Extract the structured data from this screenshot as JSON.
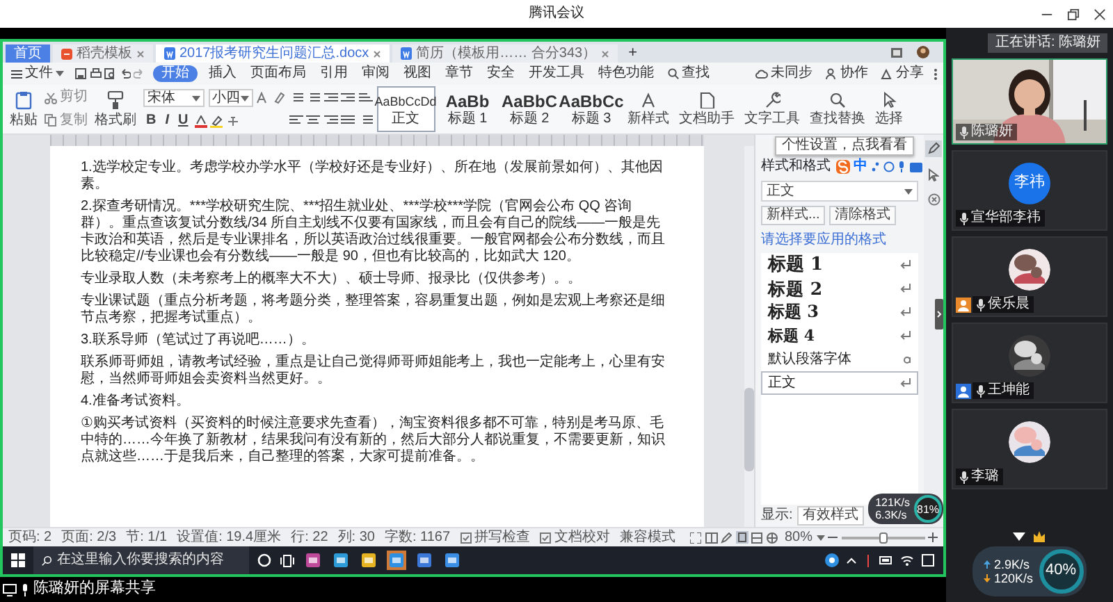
{
  "window": {
    "title": "腾讯会议"
  },
  "screen_share": {
    "doc_tabs": [
      {
        "label": "首页",
        "kind": "home",
        "selected": false
      },
      {
        "label": "稻壳模板",
        "kind": "template",
        "selected": false
      },
      {
        "label": "2017报考研究生问题汇总.docx",
        "kind": "doc",
        "selected": true
      },
      {
        "label": "简历（模板用…… 合分343）",
        "kind": "doc",
        "selected": false
      }
    ],
    "new_tab": "+",
    "file_menu": "文件",
    "menu": [
      {
        "label": "开始",
        "selected": true
      },
      {
        "label": "插入",
        "selected": false
      },
      {
        "label": "页面布局",
        "selected": false
      },
      {
        "label": "引用",
        "selected": false
      },
      {
        "label": "审阅",
        "selected": false
      },
      {
        "label": "视图",
        "selected": false
      },
      {
        "label": "章节",
        "selected": false
      },
      {
        "label": "安全",
        "selected": false
      },
      {
        "label": "开发工具",
        "selected": false
      },
      {
        "label": "特色功能",
        "selected": false
      }
    ],
    "menu_search": "查找",
    "menu_right": [
      {
        "label": "未同步",
        "kind": "cloud"
      },
      {
        "label": "协作",
        "kind": "people"
      },
      {
        "label": "分享",
        "kind": "share"
      }
    ],
    "toolbar": {
      "paste": "粘贴",
      "cut": "剪切",
      "copy": "复制",
      "format_painter": "格式刷",
      "font": "宋体",
      "font_size": "小四",
      "format_buttons": [
        "B",
        "I",
        "U"
      ],
      "styles": [
        {
          "sample": "AaBbCcDd",
          "label": "正文",
          "selected": true
        },
        {
          "sample": "AaBb",
          "label": "标题 1",
          "selected": false
        },
        {
          "sample": "AaBbC",
          "label": "标题 2",
          "selected": false
        },
        {
          "sample": "AaBbCc",
          "label": "标题 3",
          "selected": false
        }
      ],
      "tools": [
        {
          "label": "新样式",
          "kind": "style"
        },
        {
          "label": "文档助手",
          "kind": "assistant"
        },
        {
          "label": "文字工具",
          "kind": "wrench"
        },
        {
          "label": "查找替换",
          "kind": "search"
        },
        {
          "label": "选择",
          "kind": "cursor"
        }
      ],
      "tooltip": "个性设置，点我看看"
    },
    "document": {
      "paragraphs": [
        "1.选学校定专业。考虑学校办学水平（学校好还是专业好）、所在地（发展前景如何）、其他因素。",
        "2.探查考研情况。***学校研究生院、***招生就业处、***学校***学院（官网会公布 QQ 咨询群）。重点查该复试分数线/34 所自主划线不仅要有国家线，而且会有自己的院线——一般是先卡政治和英语，然后是专业课排名，所以英语政治过线很重要。一般官网都会公布分数线，而且比较稳定//专业课也会有分数线——一般是 90，但也有比较高的，比如武大 120。",
        "专业录取人数（未考察考上的概率大不大）、硕士导师、报录比（仅供参考）。。",
        "专业课试题（重点分析考题，将考题分类，整理答案，容易重复出题，例如是宏观上考察还是细节点考察，把握考试重点）。",
        "3.联系导师（笔试过了再说吧……）。",
        "联系师哥师姐，请教考试经验，重点是让自己觉得师哥师姐能考上，我也一定能考上，心里有安慰，当然师哥师姐会卖资料当然更好。。",
        "4.准备考试资料。",
        "①购买考试资料（买资料的时候注意要求先查看），淘宝资料很多都不可靠，特别是考马原、毛中特的……今年换了新教材，结果我问有没有新的，然后大部分人都说重复，不需要更新，知识点就这些……于是我后来，自己整理的答案，大家可提前准备。。"
      ]
    },
    "style_panel": {
      "title": "样式和格式",
      "current": "正文",
      "buttons": [
        "新样式...",
        "清除格式"
      ],
      "prompt": "请选择要应用的格式",
      "styles": [
        {
          "label": "标题 1",
          "kind": "heading",
          "selected": false
        },
        {
          "label": "标题 2",
          "kind": "heading",
          "selected": false
        },
        {
          "label": "标题 3",
          "kind": "heading",
          "selected": false
        },
        {
          "label": "标题 4",
          "kind": "heading",
          "selected": false
        },
        {
          "label": "默认段落字体",
          "kind": "character",
          "selected": false
        },
        {
          "label": "正文",
          "kind": "paragraph",
          "selected": true
        }
      ],
      "show_label": "显示:",
      "show_value": "有效样式"
    },
    "ime": {
      "mode": "中"
    },
    "net_monitor": {
      "upload": "121K/s",
      "download": "6.3K/s",
      "usage": "81%"
    },
    "status_bar": {
      "items": [
        "页码: 2",
        "页面: 2/3",
        "节: 1/1",
        "设置值: 19.4厘米",
        "行: 22",
        "列: 30",
        "字数: 1167"
      ],
      "checks": [
        "拼写检查",
        "文档校对"
      ],
      "mode": "兼容模式",
      "zoom": "80%",
      "zoom_slider": {
        "level": 0.5
      }
    },
    "taskbar": {
      "search_placeholder": "在这里输入你要搜索的内容"
    }
  },
  "share_label": "陈璐妍的屏幕共享",
  "participants": {
    "speaking": "正在讲话: 陈璐妍",
    "tiles": [
      {
        "name": "陈璐妍",
        "kind": "video"
      },
      {
        "name": "宣华部李祎",
        "kind": "initials",
        "avatar_text": "李祎"
      },
      {
        "name": "侯乐晨",
        "color": "#e8892c"
      },
      {
        "name": "王坤能",
        "color": "#2b6fd8"
      },
      {
        "name": "李璐"
      }
    ]
  },
  "network": {
    "upload": "2.9K/s",
    "download": "120K/s",
    "usage": "40%"
  }
}
